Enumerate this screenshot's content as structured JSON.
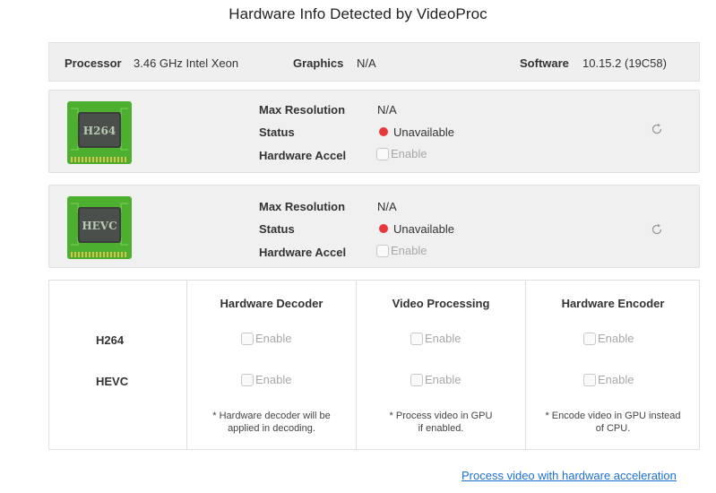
{
  "title": "Hardware Info Detected by VideoProc",
  "info": {
    "processor_label": "Processor",
    "processor_value": "3.46 GHz Intel Xeon",
    "graphics_label": "Graphics",
    "graphics_value": "N/A",
    "software_label": "Software",
    "software_value": "10.15.2 (19C58)"
  },
  "codecs": [
    {
      "chip_label": "H264",
      "max_res_label": "Max Resolution",
      "max_res_value": "N/A",
      "status_label": "Status",
      "status_value": "Unavailable",
      "accel_label": "Hardware Accel",
      "accel_checkbox": "Enable",
      "refresh_icon": "refresh-icon"
    },
    {
      "chip_label": "HEVC",
      "max_res_label": "Max Resolution",
      "max_res_value": "N/A",
      "status_label": "Status",
      "status_value": "Unavailable",
      "accel_label": "Hardware Accel",
      "accel_checkbox": "Enable",
      "refresh_icon": "refresh-icon"
    }
  ],
  "matrix": {
    "columns": [
      "Hardware Decoder",
      "Video Processing",
      "Hardware Encoder"
    ],
    "rows": [
      {
        "label": "H264",
        "cells": [
          "Enable",
          "Enable",
          "Enable"
        ]
      },
      {
        "label": "HEVC",
        "cells": [
          "Enable",
          "Enable",
          "Enable"
        ]
      }
    ],
    "notes": [
      [
        "* Hardware decoder will be",
        "applied in decoding."
      ],
      [
        "* Process video in GPU",
        "if enabled."
      ],
      [
        "* Encode video in GPU instead",
        "of CPU."
      ]
    ]
  },
  "link_text": "Process video with hardware acceleration",
  "colors": {
    "status_dot": "#e8373b",
    "link": "#1a6fd1",
    "chip_board": "#4caf2f"
  }
}
